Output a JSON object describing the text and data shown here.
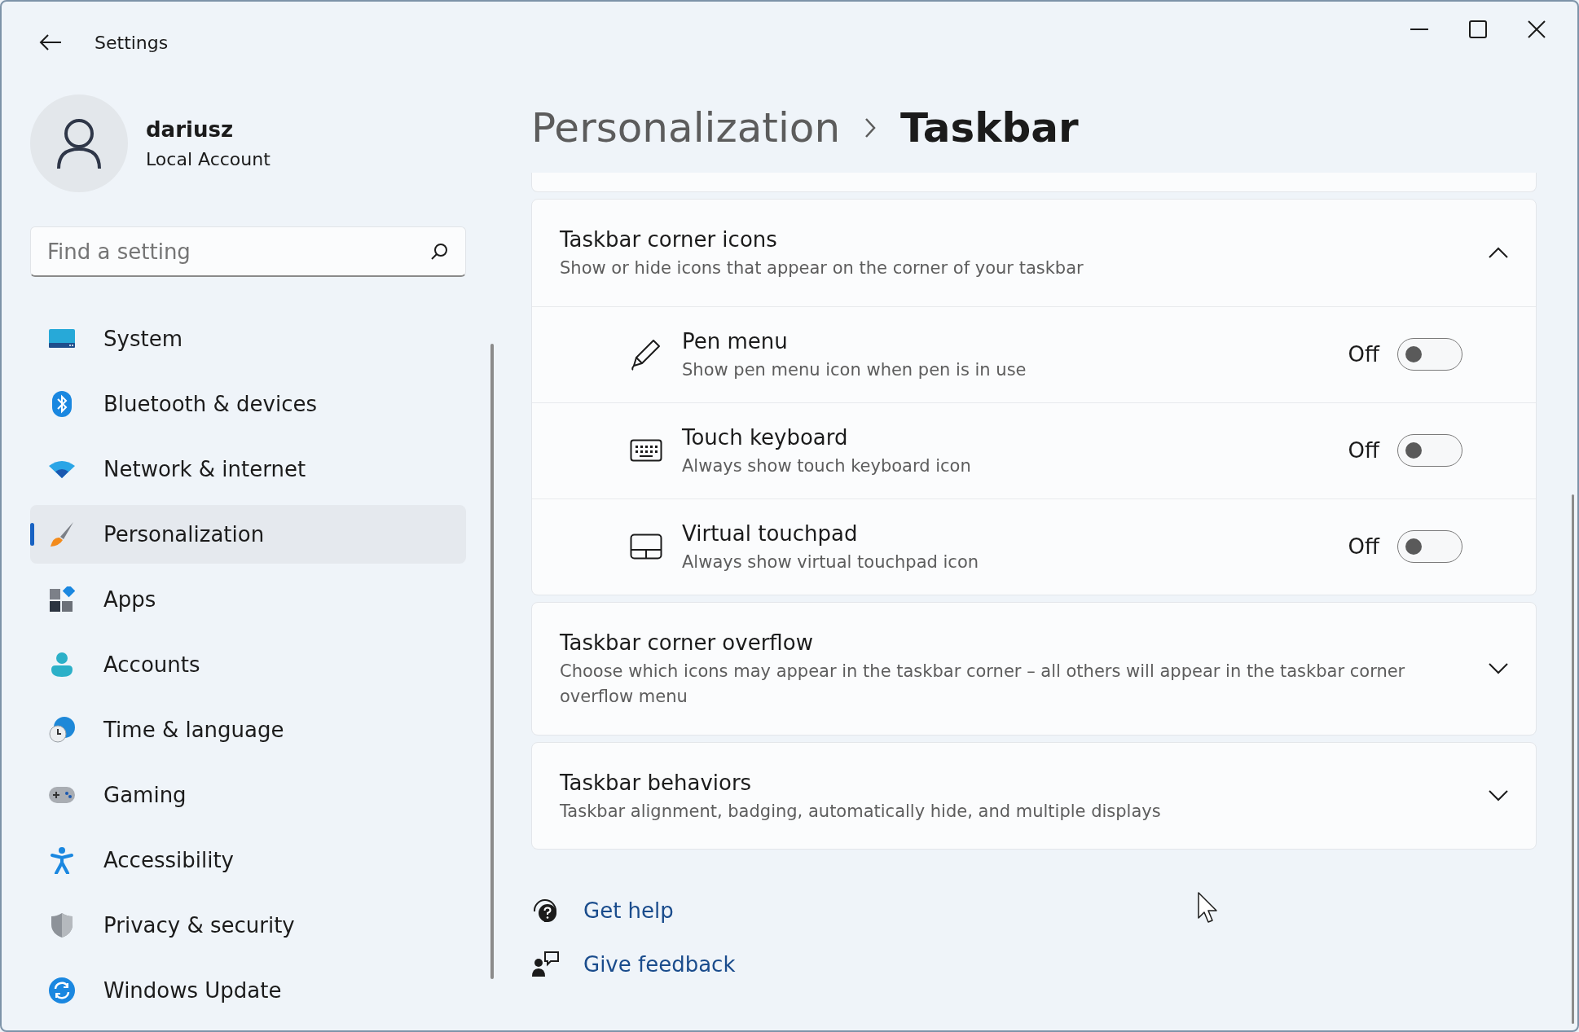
{
  "window": {
    "title": "Settings"
  },
  "account": {
    "name": "dariusz",
    "type": "Local Account"
  },
  "search": {
    "placeholder": "Find a setting"
  },
  "sidebar": {
    "items": [
      {
        "label": "System",
        "selected": false
      },
      {
        "label": "Bluetooth & devices",
        "selected": false
      },
      {
        "label": "Network & internet",
        "selected": false
      },
      {
        "label": "Personalization",
        "selected": true
      },
      {
        "label": "Apps",
        "selected": false
      },
      {
        "label": "Accounts",
        "selected": false
      },
      {
        "label": "Time & language",
        "selected": false
      },
      {
        "label": "Gaming",
        "selected": false
      },
      {
        "label": "Accessibility",
        "selected": false
      },
      {
        "label": "Privacy & security",
        "selected": false
      },
      {
        "label": "Windows Update",
        "selected": false
      }
    ]
  },
  "breadcrumb": [
    "Personalization",
    "Taskbar"
  ],
  "sections": [
    {
      "title": "Taskbar corner icons",
      "subtitle": "Show or hide icons that appear on the corner of your taskbar",
      "expanded": true,
      "children": [
        {
          "title": "Pen menu",
          "subtitle": "Show pen menu icon when pen is in use",
          "state_label": "Off",
          "on": false
        },
        {
          "title": "Touch keyboard",
          "subtitle": "Always show touch keyboard icon",
          "state_label": "Off",
          "on": false
        },
        {
          "title": "Virtual touchpad",
          "subtitle": "Always show virtual touchpad icon",
          "state_label": "Off",
          "on": false
        }
      ]
    },
    {
      "title": "Taskbar corner overflow",
      "subtitle": "Choose which icons may appear in the taskbar corner – all others will appear in the taskbar corner overflow menu",
      "expanded": false
    },
    {
      "title": "Taskbar behaviors",
      "subtitle": "Taskbar alignment, badging, automatically hide, and multiple displays",
      "expanded": false
    }
  ],
  "links": [
    {
      "label": "Get help"
    },
    {
      "label": "Give feedback"
    }
  ]
}
